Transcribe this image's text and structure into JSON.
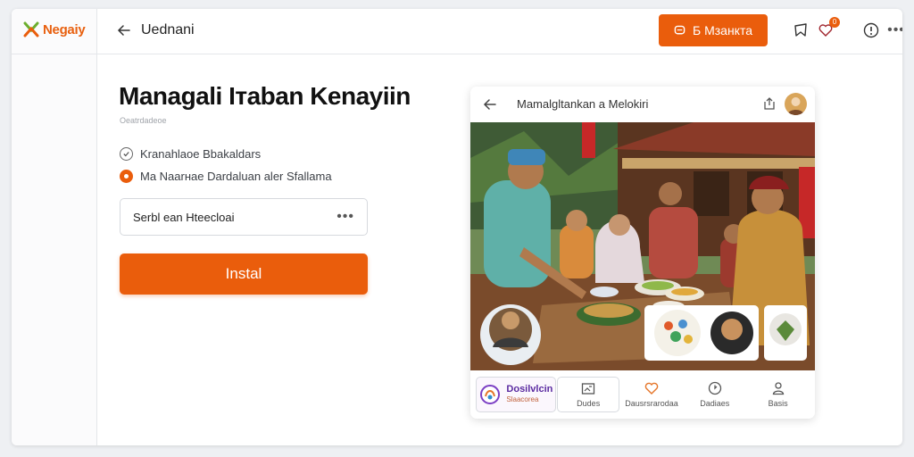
{
  "app": {
    "name": "Negaiy"
  },
  "topbar": {
    "title": "Uednani",
    "primary_button_label": "Б Мзанкта",
    "notification_count": "0",
    "icons": [
      "arrow-left-icon",
      "chat-icon",
      "bookmark-icon",
      "heart-icon",
      "info-icon",
      "more-icon"
    ]
  },
  "main": {
    "title": "Managali Ітаbаn Kenayiin",
    "subtitle": "Oeatrdadeoe",
    "options": [
      {
        "label": "Kranahlaoe Bbakaldars",
        "state": "checked"
      },
      {
        "label": "Ma Naarнae Dardaluan aler Sfallama",
        "state": "selected"
      }
    ],
    "select": {
      "value": "Serbl ean Нteecloai"
    },
    "install_label": "Instal"
  },
  "preview": {
    "title": "Mamalgltankan a Melokiri",
    "tabs": [
      {
        "label_1": "Dosilvlcin",
        "label_2": "Slaacorea",
        "icon": "brand-logo-icon"
      },
      {
        "label": "Dudes",
        "icon": "image-icon"
      },
      {
        "label": "Dausrsrarodaa",
        "icon": "heart-icon"
      },
      {
        "label": "Dadiaes",
        "icon": "clock-icon"
      },
      {
        "label": "Basis",
        "icon": "person-icon"
      }
    ]
  },
  "colors": {
    "accent": "#ea5d0c",
    "background": "#eef0f3",
    "brand_purple": "#5a2aa0"
  }
}
